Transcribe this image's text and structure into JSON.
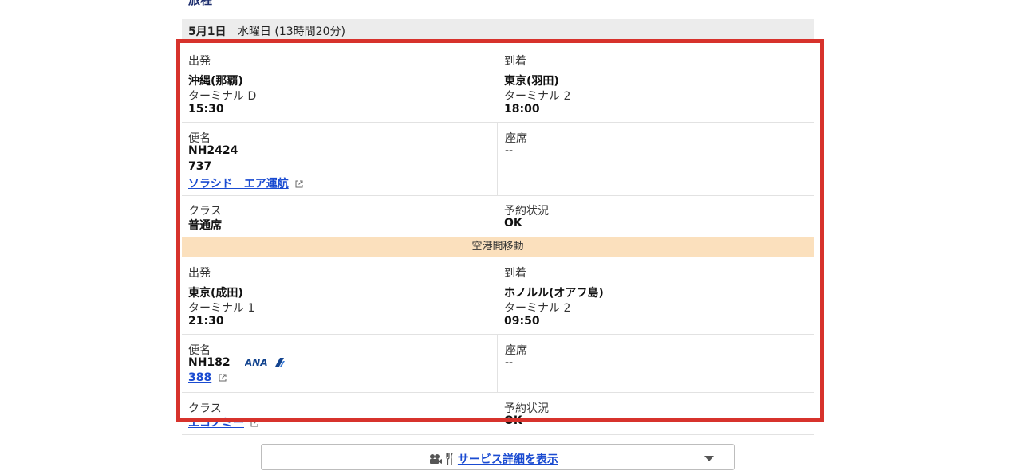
{
  "section": {
    "title": "旅程"
  },
  "day": {
    "date": "5月1日",
    "detail": "水曜日 (13時間20分)"
  },
  "segments": [
    {
      "depart": {
        "label": "出発",
        "city": "沖縄(那覇)",
        "terminal": "ターミナル D",
        "time": "15:30"
      },
      "arrive": {
        "label": "到着",
        "city": "東京(羽田)",
        "terminal": "ターミナル 2",
        "time": "18:00"
      },
      "flight": {
        "label": "便名",
        "number": "NH2424",
        "aircraft": "737",
        "operator": "ソラシド　エア運航"
      },
      "seat": {
        "label": "座席",
        "value": "--"
      },
      "class": {
        "label": "クラス",
        "value": "普通席"
      },
      "status": {
        "label": "予約状況",
        "value": "OK"
      }
    },
    {
      "depart": {
        "label": "出発",
        "city": "東京(成田)",
        "terminal": "ターミナル 1",
        "time": "21:30"
      },
      "arrive": {
        "label": "到着",
        "city": "ホノルル(オアフ島)",
        "terminal": "ターミナル 2",
        "time": "09:50"
      },
      "flight": {
        "label": "便名",
        "number": "NH182",
        "airline_logo": "ANA",
        "aircraft": "388"
      },
      "seat": {
        "label": "座席",
        "value": "--"
      },
      "class": {
        "label": "クラス",
        "value": "エコノミー"
      },
      "status": {
        "label": "予約状況",
        "value": "OK"
      }
    }
  ],
  "transfer": {
    "label": "空港間移動"
  },
  "service_button": {
    "label": "サービス詳細を表示",
    "icons": [
      "camera-icon",
      "utensils-icon"
    ]
  },
  "colors": {
    "highlight_box": "#d7322c",
    "link": "#1a4bd1",
    "transfer_bg": "#fbe0bd",
    "header_bg": "#ececec",
    "ana_blue": "#13448f"
  }
}
